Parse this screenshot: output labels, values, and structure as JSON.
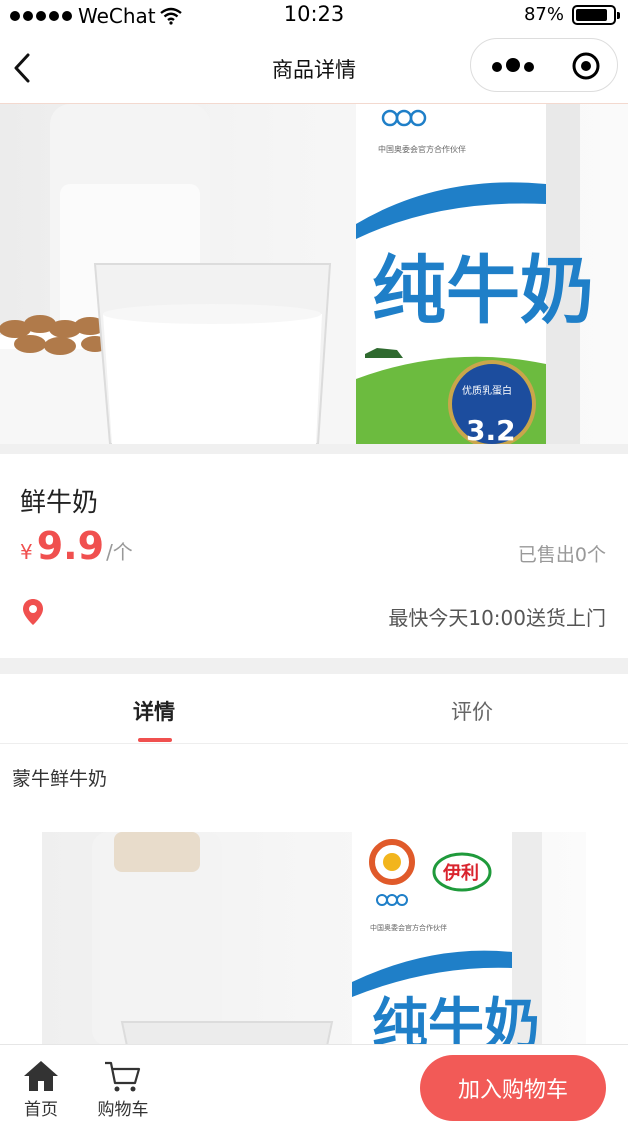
{
  "status_bar": {
    "carrier": "WeChat",
    "time": "10:23",
    "battery": "87%",
    "battery_level": 0.87
  },
  "nav": {
    "title": "商品详情"
  },
  "hero": {
    "package_title": "纯牛奶",
    "protein_badge": "优质乳蛋白",
    "protein_value": "3.2"
  },
  "product": {
    "name": "鲜牛奶",
    "currency": "¥",
    "price": "9.9",
    "unit": "/个",
    "sold": "已售出0个",
    "delivery": "最快今天10:00送货上门"
  },
  "tabs": [
    {
      "label": "详情",
      "active": true
    },
    {
      "label": "评价",
      "active": false
    }
  ],
  "description": "蒙牛鲜牛奶",
  "detail_image": {
    "brand": "伊利",
    "package_title": "纯牛奶"
  },
  "bottom_bar": {
    "home_label": "首页",
    "cart_label": "购物车",
    "add_to_cart": "加入购物车"
  },
  "colors": {
    "accent": "#f0504f",
    "button": "#f25a57",
    "carton_blue": "#1f7fc8"
  }
}
